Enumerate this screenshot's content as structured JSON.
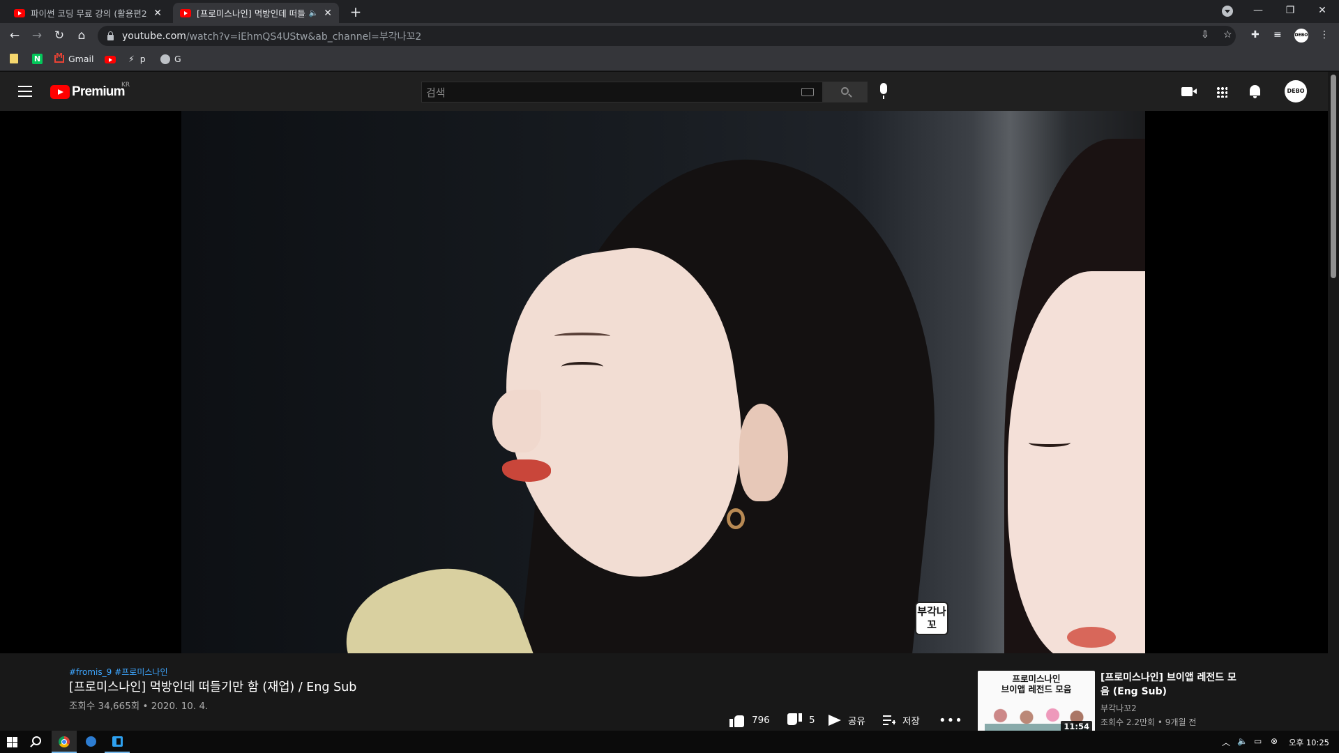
{
  "browser": {
    "tabs": [
      {
        "title": "파이썬 코딩 무료 강의 (활용편2)",
        "active": false
      },
      {
        "title": "[프로미스나인] 먹방인데 떠들기만 함",
        "active": true
      }
    ],
    "url_host": "youtube.com",
    "url_path": "/watch?v=iEhmQS4UStw&ab_channel=부각나꼬2",
    "bookmarks": [
      {
        "label": "",
        "icon": "folder-icon"
      },
      {
        "label": "N",
        "icon": "naver-icon"
      },
      {
        "label": "Gmail",
        "icon": "gmail-icon"
      },
      {
        "label": "",
        "icon": "youtube-icon"
      },
      {
        "label": "p",
        "icon": "bolt-icon"
      },
      {
        "label": "G",
        "icon": "github-icon"
      }
    ]
  },
  "youtube": {
    "logo_text": "Premium",
    "region": "KR",
    "search_placeholder": "검색",
    "avatar_text": "DEBO"
  },
  "video": {
    "watermark": "부각나꼬",
    "hashtags": [
      "#fromis_9",
      "#프로미스나인"
    ],
    "title": "[프로미스나인] 먹방인데 떠들기만 함 (재업) / Eng Sub",
    "meta": "조회수 34,665회 • 2020. 10. 4.",
    "likes": "796",
    "dislikes": "5",
    "share_label": "공유",
    "save_label": "저장",
    "more_label": "•••"
  },
  "recommended": {
    "thumb_text_line1": "프로미스나인",
    "thumb_text_line2": "브이앱 레전드 모음",
    "duration": "11:54",
    "title": "[프로미스나인] 브이앱 레전드 모음 (Eng Sub)",
    "channel": "부각나꼬2",
    "meta": "조회수 2.2만회 • 9개월 전"
  },
  "taskbar": {
    "clock": "오후 10:25"
  }
}
